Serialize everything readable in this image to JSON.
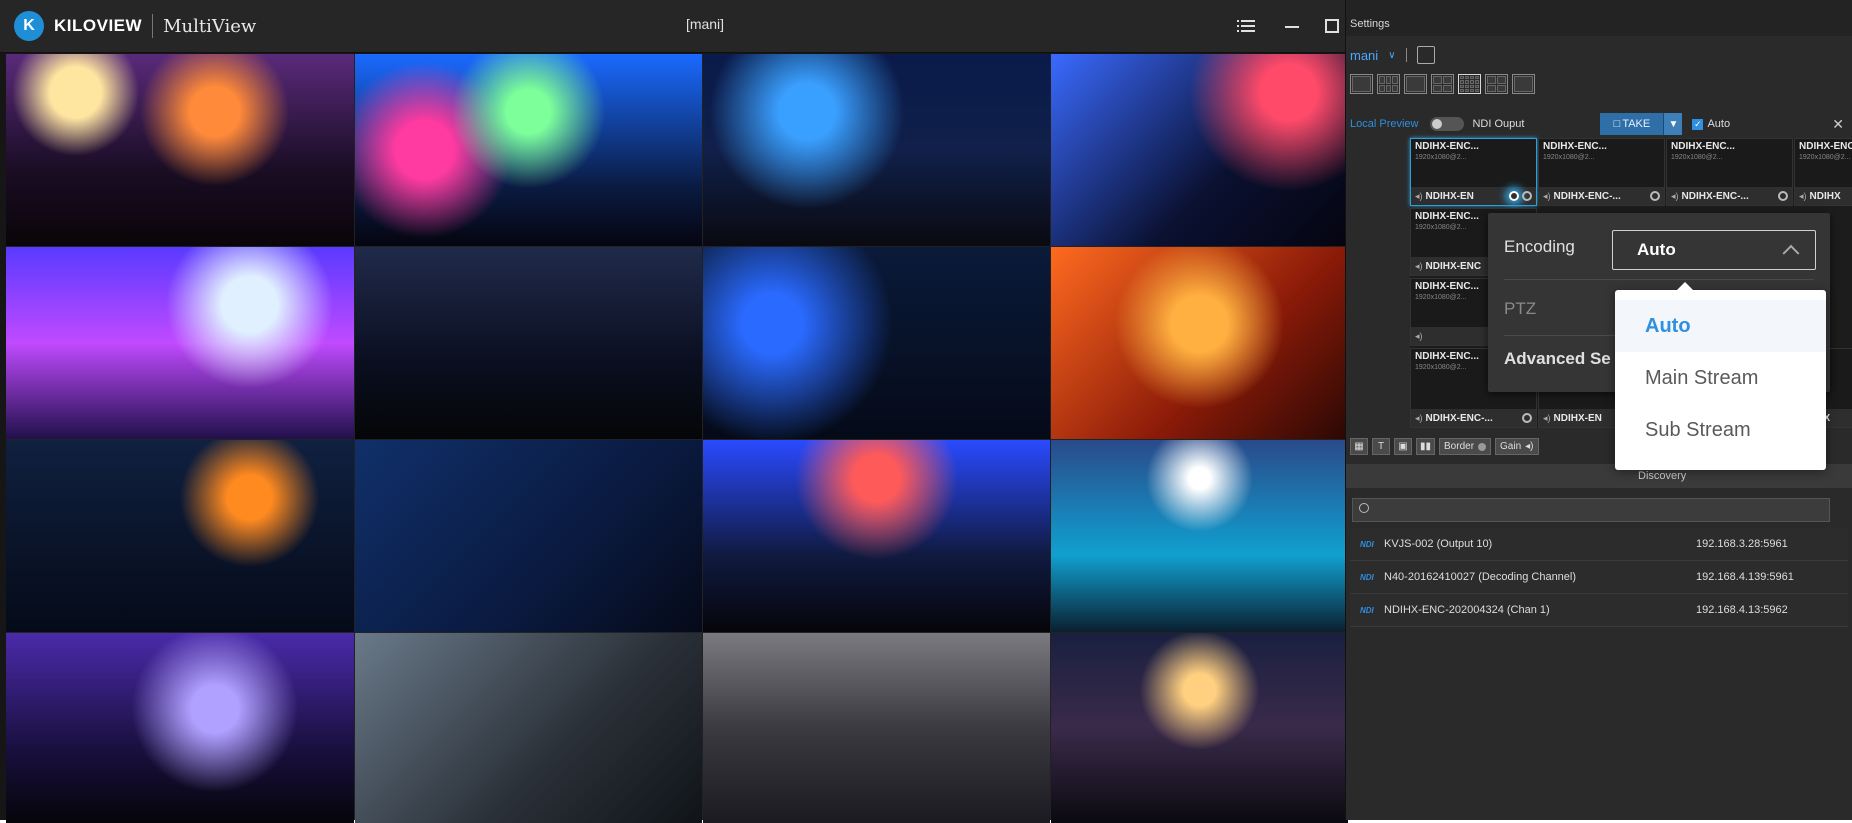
{
  "app": {
    "brand": "KILOVIEW",
    "product": "MultiView",
    "layout_name": "[mani]"
  },
  "settings": {
    "title": "Settings",
    "layout_select": "mani",
    "local_preview_label": "Local Preview",
    "ndi_output_label": "NDI Ouput",
    "take_label": "TAKE",
    "auto_label": "Auto",
    "sources": [
      {
        "name": "NDIHX-ENC...",
        "res": "1920x1080@2...",
        "foot": "NDIHX-EN"
      },
      {
        "name": "NDIHX-ENC...",
        "res": "1920x1080@2...",
        "foot": "NDIHX-ENC-..."
      },
      {
        "name": "NDIHX-ENC...",
        "res": "1920x1080@2...",
        "foot": "NDIHX-ENC-..."
      },
      {
        "name": "NDIHX-ENC...",
        "res": "1920x1080@2...",
        "foot": "NDIHX"
      },
      {
        "name": "NDIHX-ENC...",
        "res": "1920x1080@2...",
        "foot": ""
      },
      {
        "name": "",
        "res": "",
        "foot": "NDIHX-ENC"
      },
      {
        "name": "NDIHX-ENC...",
        "res": "1920x1080@2...",
        "foot": ""
      },
      {
        "name": "NDIHX-ENC...",
        "res": "1920x1080@2...",
        "foot": ""
      },
      {
        "name": "",
        "res": "",
        "foot": "NDIHX-ENC-..."
      },
      {
        "name": "",
        "res": "",
        "foot": "NDIHX-EN"
      },
      {
        "name": "",
        "res": "",
        "foot": "NDIHX"
      }
    ],
    "border_label": "Border",
    "gain_label": "Gain",
    "discovery_label": "Discovery",
    "discovery": [
      {
        "tag": "NDI",
        "name": "KVJS-002 (Output 10)",
        "ip": "192.168.3.28:5961"
      },
      {
        "tag": "NDI",
        "name": "N40-20162410027 (Decoding Channel)",
        "ip": "192.168.4.139:5961"
      },
      {
        "tag": "NDI",
        "name": "NDIHX-ENC-202004324 (Chan 1)",
        "ip": "192.168.4.13:5962"
      }
    ]
  },
  "popup": {
    "encoding_label": "Encoding",
    "encoding_value": "Auto",
    "ptz_label": "PTZ",
    "advanced_label": "Advanced Se",
    "options": [
      "Auto",
      "Main Stream",
      "Sub Stream"
    ],
    "selected_option": "Auto"
  },
  "colors": {
    "accent": "#2f8fe0",
    "panel": "#2a2a2a",
    "selection_glow": "#2f9fd8"
  }
}
